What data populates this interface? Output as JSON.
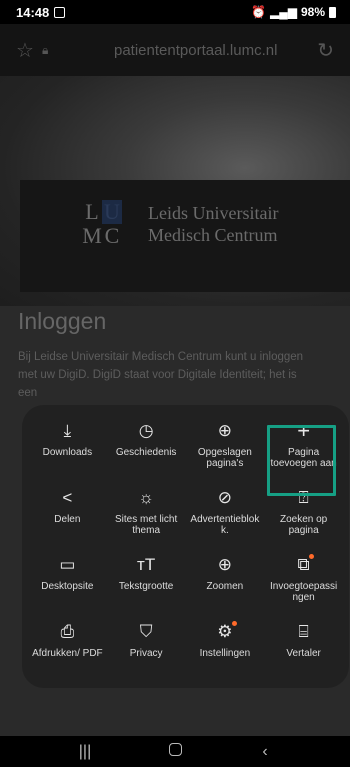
{
  "status_bar": {
    "time": "14:48",
    "battery": "98%"
  },
  "browser": {
    "url": "patiententportaal.lumc.nl"
  },
  "page": {
    "logo_letters": [
      "L",
      "U",
      "M",
      "C"
    ],
    "logo_line1": "Leids Universitair",
    "logo_line2": "Medisch Centrum",
    "title": "Inloggen",
    "text": "Bij Leidse Universitair Medisch Centrum kunt u inloggen met uw DigiD. DigiD staat voor Digitale Identiteit; het is een"
  },
  "menu": {
    "items": [
      {
        "label": "Downloads",
        "icon": "download-icon"
      },
      {
        "label": "Geschiedenis",
        "icon": "history-icon"
      },
      {
        "label": "Opgeslagen pagina's",
        "icon": "saved-pages-icon"
      },
      {
        "label": "Pagina toevoegen aan",
        "icon": "plus-icon"
      },
      {
        "label": "Delen",
        "icon": "share-icon"
      },
      {
        "label": "Sites met licht thema",
        "icon": "light-theme-icon"
      },
      {
        "label": "Advertentieblokk.",
        "icon": "ad-block-icon"
      },
      {
        "label": "Zoeken op pagina",
        "icon": "find-in-page-icon"
      },
      {
        "label": "Desktopsite",
        "icon": "desktop-icon"
      },
      {
        "label": "Tekstgrootte",
        "icon": "text-size-icon"
      },
      {
        "label": "Zoomen",
        "icon": "zoom-icon"
      },
      {
        "label": "Invoegtoepassingen",
        "icon": "add-ons-icon"
      },
      {
        "label": "Afdrukken/ PDF",
        "icon": "print-icon"
      },
      {
        "label": "Privacy",
        "icon": "privacy-icon"
      },
      {
        "label": "Instellingen",
        "icon": "settings-icon"
      },
      {
        "label": "Vertaler",
        "icon": "translate-icon"
      }
    ]
  },
  "colors": {
    "highlight": "#16a085",
    "badge": "#ff6a2a"
  }
}
